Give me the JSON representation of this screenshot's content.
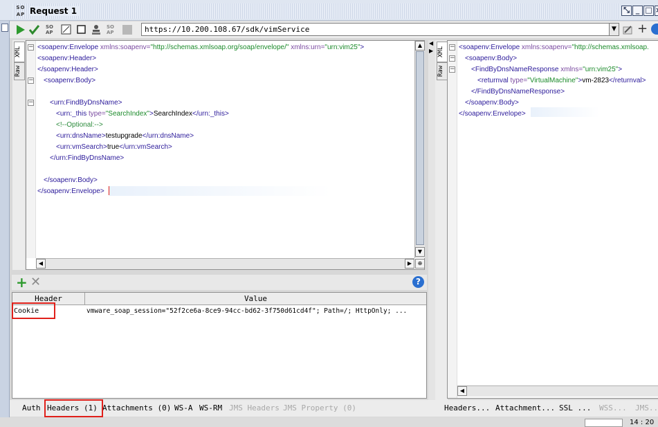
{
  "window": {
    "logo_text": "SO AP",
    "title": "Request 1",
    "buttons": [
      "restore",
      "minimize",
      "maximize",
      "close"
    ]
  },
  "toolbar": {
    "endpoint": "https://10.200.108.67/sdk/vimService",
    "add_label": "+"
  },
  "request_editor": {
    "tabs": [
      "XML",
      "Raw"
    ],
    "lines": [
      {
        "indent": 0,
        "fold": "-",
        "parts": [
          [
            "tag",
            "<soapenv:Envelope "
          ],
          [
            "attr",
            "xmlns:soapenv="
          ],
          [
            "aval",
            "\"http://schemas.xmlsoap.org/soap/envelope/\" "
          ],
          [
            "attr",
            "xmlns:urn="
          ],
          [
            "aval",
            "\"urn:vim25\""
          ],
          [
            "tag",
            ">"
          ]
        ]
      },
      {
        "indent": 0,
        "fold": "",
        "parts": [
          [
            "tag",
            "<soapenv:Header>"
          ]
        ]
      },
      {
        "indent": 0,
        "fold": "",
        "parts": [
          [
            "tag",
            "</soapenv:Header>"
          ]
        ]
      },
      {
        "indent": 1,
        "fold": "-",
        "parts": [
          [
            "tag",
            "<soapenv:Body>"
          ]
        ]
      },
      {
        "indent": 0,
        "fold": "",
        "parts": []
      },
      {
        "indent": 2,
        "fold": "-",
        "parts": [
          [
            "tag",
            "<urn:FindByDnsName>"
          ]
        ]
      },
      {
        "indent": 3,
        "fold": "",
        "parts": [
          [
            "tag",
            "<urn:_this "
          ],
          [
            "attr",
            "type="
          ],
          [
            "aval",
            "\"SearchIndex\""
          ],
          [
            "tag",
            ">"
          ],
          [
            "txt",
            "SearchIndex"
          ],
          [
            "tag",
            "</urn:_this>"
          ]
        ]
      },
      {
        "indent": 3,
        "fold": "",
        "parts": [
          [
            "cmt",
            "<!--Optional:-->"
          ]
        ]
      },
      {
        "indent": 3,
        "fold": "",
        "parts": [
          [
            "tag",
            "<urn:dnsName>"
          ],
          [
            "txt",
            "testupgrade"
          ],
          [
            "tag",
            "</urn:dnsName>"
          ]
        ]
      },
      {
        "indent": 3,
        "fold": "",
        "parts": [
          [
            "tag",
            "<urn:vmSearch>"
          ],
          [
            "txt",
            "true"
          ],
          [
            "tag",
            "</urn:vmSearch>"
          ]
        ]
      },
      {
        "indent": 2,
        "fold": "",
        "parts": [
          [
            "tag",
            "</urn:FindByDnsName>"
          ]
        ]
      },
      {
        "indent": 0,
        "fold": "",
        "parts": []
      },
      {
        "indent": 1,
        "fold": "",
        "parts": [
          [
            "tag",
            "</soapenv:Body>"
          ]
        ]
      },
      {
        "indent": 0,
        "fold": "",
        "parts": [
          [
            "tag",
            "</soapenv:Envelope>"
          ]
        ]
      }
    ]
  },
  "response_editor": {
    "tabs": [
      "XML",
      "Raw"
    ],
    "lines": [
      {
        "indent": 0,
        "fold": "-",
        "parts": [
          [
            "tag",
            "<soapenv:Envelope "
          ],
          [
            "attr",
            "xmlns:soapenv="
          ],
          [
            "aval",
            "\"http://schemas.xmlsoap.org/soap/envelope/\""
          ]
        ]
      },
      {
        "indent": 1,
        "fold": "-",
        "parts": [
          [
            "tag",
            "<soapenv:Body>"
          ]
        ]
      },
      {
        "indent": 2,
        "fold": "-",
        "parts": [
          [
            "tag",
            "<FindByDnsNameResponse "
          ],
          [
            "attr",
            "xmlns="
          ],
          [
            "aval",
            "\"urn:vim25\""
          ],
          [
            "tag",
            ">"
          ]
        ]
      },
      {
        "indent": 3,
        "fold": "",
        "parts": [
          [
            "tag",
            "<returnval "
          ],
          [
            "attr",
            "type="
          ],
          [
            "aval",
            "\"VirtualMachine\""
          ],
          [
            "tag",
            ">"
          ],
          [
            "txt",
            "vm-2823"
          ],
          [
            "tag",
            "</returnval>"
          ]
        ]
      },
      {
        "indent": 2,
        "fold": "",
        "parts": [
          [
            "tag",
            "</FindByDnsNameResponse>"
          ]
        ]
      },
      {
        "indent": 1,
        "fold": "",
        "parts": [
          [
            "tag",
            "</soapenv:Body>"
          ]
        ]
      },
      {
        "indent": 0,
        "fold": "",
        "parts": [
          [
            "tag",
            "</soapenv:Envelope>"
          ]
        ]
      }
    ]
  },
  "headers_panel": {
    "columns": [
      "Header",
      "Value"
    ],
    "rows": [
      {
        "header": "Cookie",
        "value": "vmware_soap_session=\"52f2ce6a-8ce9-94cc-bd62-3f750d61cd4f\"; Path=/; HttpOnly; ..."
      }
    ],
    "help_label": "?"
  },
  "request_tabs": [
    {
      "label": "Auth",
      "disabled": false
    },
    {
      "label": "Headers (1)",
      "disabled": false,
      "highlighted": true
    },
    {
      "label": "Attachments (0)",
      "disabled": false
    },
    {
      "label": "WS-A",
      "disabled": false
    },
    {
      "label": "WS-RM",
      "disabled": false
    },
    {
      "label": "JMS Headers",
      "disabled": true
    },
    {
      "label": "JMS Property (0)",
      "disabled": true
    }
  ],
  "response_tabs": [
    {
      "label": "Headers...",
      "disabled": false
    },
    {
      "label": "Attachment...",
      "disabled": false
    },
    {
      "label": "SSL ...",
      "disabled": false
    },
    {
      "label": "WSS...",
      "disabled": true
    },
    {
      "label": "JMS...",
      "disabled": true
    }
  ],
  "status": {
    "position": "14 : 20"
  },
  "colors": {
    "tag": "#2b1a9a",
    "attr": "#7a4aa0",
    "aval": "#1b8a2a",
    "highlight": "#e0201a"
  }
}
